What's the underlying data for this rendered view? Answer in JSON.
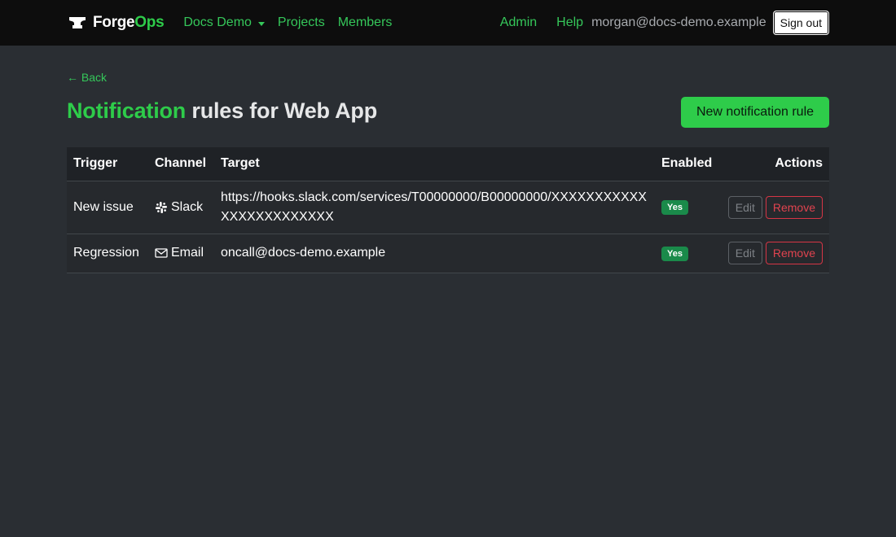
{
  "navbar": {
    "brand_part1": "Forge",
    "brand_part2": "Ops",
    "org_dropdown": "Docs Demo",
    "projects": "Projects",
    "members": "Members",
    "admin": "Admin",
    "help": "Help",
    "user_email": "morgan@docs-demo.example",
    "sign_out": "Sign out"
  },
  "page": {
    "back": "← Back",
    "title_accent": "Notification",
    "title_rest": " rules for Web App",
    "new_rule_button": "New notification rule"
  },
  "table": {
    "headers": {
      "trigger": "Trigger",
      "channel": "Channel",
      "target": "Target",
      "enabled": "Enabled",
      "actions": "Actions"
    },
    "rows": [
      {
        "trigger": "New issue",
        "channel": "Slack",
        "channel_icon": "slack-icon",
        "target": "https://hooks.slack.com/services/T00000000/B00000000/XXXXXXXXXXXXXXXXXXXXXXXX",
        "enabled": "Yes",
        "edit": "Edit",
        "remove": "Remove"
      },
      {
        "trigger": "Regression",
        "channel": "Email",
        "channel_icon": "envelope-icon",
        "target": "oncall@docs-demo.example",
        "enabled": "Yes",
        "edit": "Edit",
        "remove": "Remove"
      }
    ]
  },
  "colors": {
    "accent": "#2ecc4a",
    "background": "#2a2e33",
    "navbar": "#0d0d0d",
    "badge_success": "#1a8a4a",
    "danger": "#d63545"
  }
}
